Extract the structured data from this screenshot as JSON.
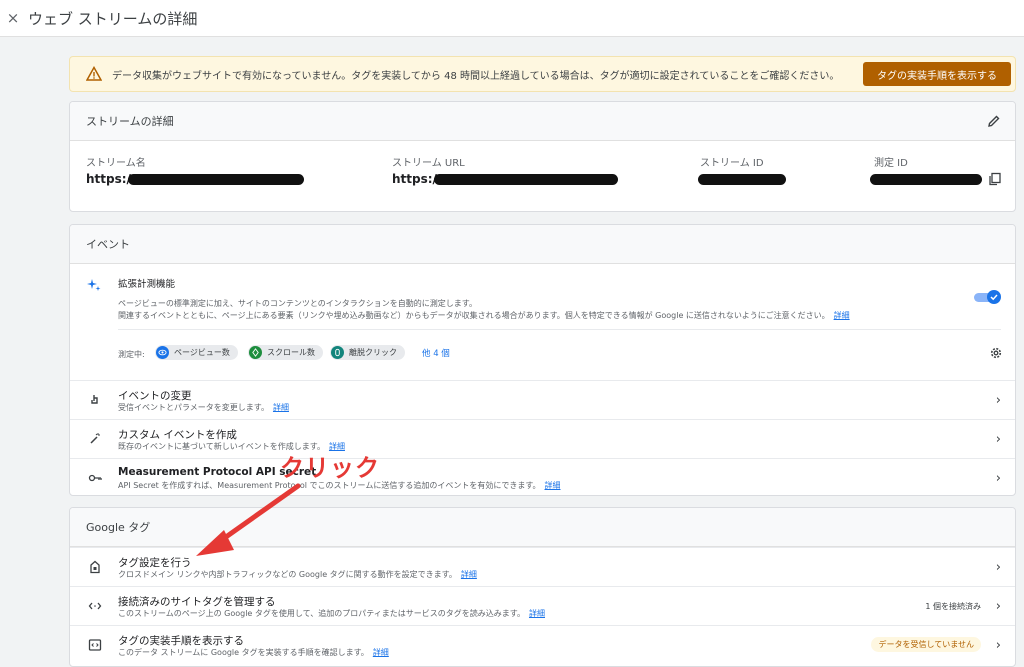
{
  "topbar": {
    "close_icon": "×",
    "title": "ウェブ ストリームの詳細"
  },
  "warning": {
    "text": "データ収集がウェブサイトで有効になっていません。タグを実装してから 48 時間以上経過している場合は、タグが適切に設定されていることをご確認ください。",
    "button": "タグの実装手順を表示する",
    "button_color": "#b06000"
  },
  "stream_details": {
    "title": "ストリームの詳細",
    "name_label": "ストリーム名",
    "name_value": "https:/",
    "url_label": "ストリーム URL",
    "url_value": "https:/",
    "id_label": "ストリーム ID",
    "measurement_label": "測定 ID"
  },
  "events": {
    "title": "イベント",
    "enhanced": {
      "title": "拡張計測機能",
      "desc1": "ページビューの標準測定に加え、サイトのコンテンツとのインタラクションを自動的に測定します。",
      "desc2": "関連するイベントとともに、ページ上にある要素（リンクや埋め込み動画など）からもデータが収集される場合があります。個人を特定できる情報が Google に送信されないようにご注意ください。",
      "link": "詳細",
      "toggle_on": true,
      "measuring_label": "測定中:",
      "chips": [
        "ページビュー数",
        "スクロール数",
        "離脱クリック"
      ],
      "more": "他 4 個"
    },
    "rows": [
      {
        "title": "イベントの変更",
        "desc": "受信イベントとパラメータを変更します。",
        "link": "詳細"
      },
      {
        "title": "カスタム イベントを作成",
        "desc": "既存のイベントに基づいて新しいイベントを作成します。",
        "link": "詳細"
      },
      {
        "title": "Measurement Protocol API secret",
        "desc": "API Secret を作成すれば、Measurement Protocol でこのストリームに送信する追加のイベントを有効にできます。",
        "link": "詳細"
      }
    ]
  },
  "annotation": {
    "text": "クリック",
    "color": "#e53935"
  },
  "google_tag": {
    "title": "Google タグ",
    "rows": [
      {
        "title": "タグ設定を行う",
        "desc": "クロスドメイン リンクや内部トラフィックなどの Google タグに関する動作を設定できます。",
        "link": "詳細",
        "badge": ""
      },
      {
        "title": "接続済みのサイトタグを管理する",
        "desc": "このストリームのページ上の Google タグを使用して、追加のプロパティまたはサービスのタグを読み込みます。",
        "link": "詳細",
        "badge": "1 個を接続済み"
      },
      {
        "title": "タグの実装手順を表示する",
        "desc": "このデータ ストリームに Google タグを実装する手順を確認します。",
        "link": "詳細",
        "badge": "データを受信していません"
      }
    ]
  }
}
